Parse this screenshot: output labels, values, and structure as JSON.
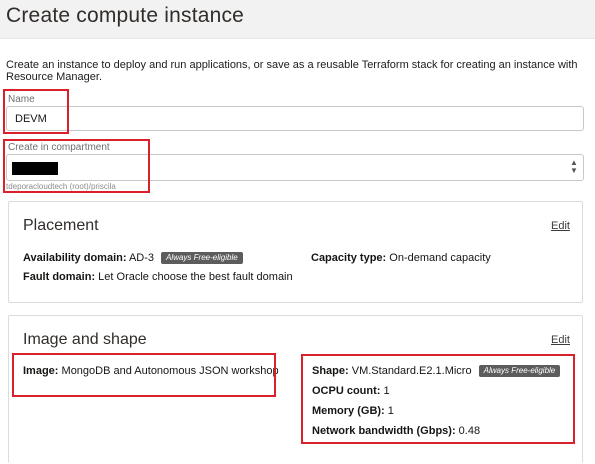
{
  "page": {
    "title": "Create compute instance",
    "intro": "Create an instance to deploy and run applications, or save as a reusable Terraform stack for creating an instance with Resource Manager."
  },
  "name_field": {
    "label": "Name",
    "value": "DEVM"
  },
  "compartment_field": {
    "label": "Create in compartment",
    "path_hint": "tdeporacloudtech (root)/priscila"
  },
  "placement": {
    "title": "Placement",
    "edit_label": "Edit",
    "availability_domain_label": "Availability domain:",
    "availability_domain_value": "AD-3",
    "availability_badge": "Always Free-eligible",
    "capacity_type_label": "Capacity type:",
    "capacity_type_value": "On-demand capacity",
    "fault_domain_label": "Fault domain:",
    "fault_domain_value": "Let Oracle choose the best fault domain"
  },
  "image_shape": {
    "title": "Image and shape",
    "edit_label": "Edit",
    "image_label": "Image:",
    "image_value": "MongoDB and Autonomous JSON workshop",
    "shape_label": "Shape:",
    "shape_value": "VM.Standard.E2.1.Micro",
    "shape_badge": "Always Free-eligible",
    "ocpu_label": "OCPU count:",
    "ocpu_value": "1",
    "memory_label": "Memory (GB):",
    "memory_value": "1",
    "bandwidth_label": "Network bandwidth (Gbps):",
    "bandwidth_value": "0.48"
  },
  "colors": {
    "highlight": "#d9202b",
    "badge": "#5c5c5c"
  }
}
